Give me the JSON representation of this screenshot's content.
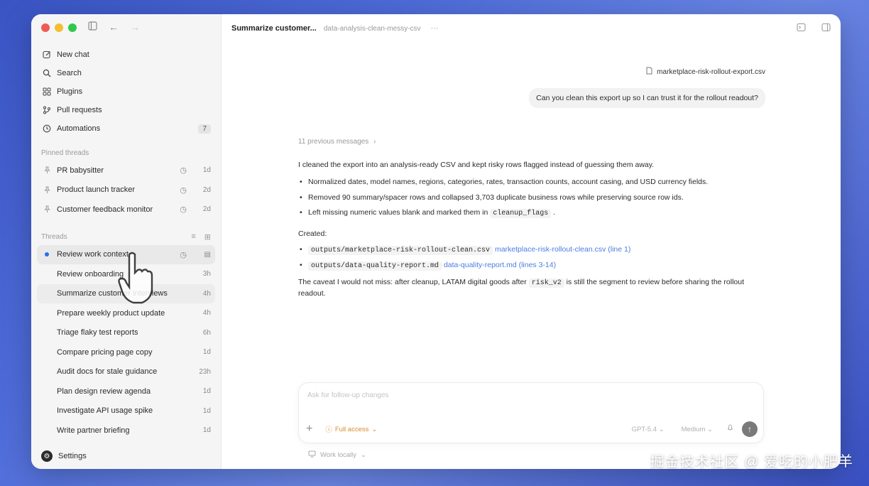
{
  "sidebar": {
    "nav": [
      {
        "label": "New chat",
        "icon": "edit-icon"
      },
      {
        "label": "Search",
        "icon": "search-icon"
      },
      {
        "label": "Plugins",
        "icon": "grid-icon"
      },
      {
        "label": "Pull requests",
        "icon": "branch-icon"
      },
      {
        "label": "Automations",
        "icon": "clock-icon",
        "badge": "7"
      }
    ],
    "pinned_label": "Pinned threads",
    "pinned": [
      {
        "title": "PR babysitter",
        "time": "1d"
      },
      {
        "title": "Product launch tracker",
        "time": "2d"
      },
      {
        "title": "Customer feedback monitor",
        "time": "2d"
      }
    ],
    "threads_label": "Threads",
    "threads": [
      {
        "title": "Review work context",
        "time": ""
      },
      {
        "title": "Review onboarding",
        "time": "3h"
      },
      {
        "title": "Summarize customer interviews",
        "time": "4h"
      },
      {
        "title": "Prepare weekly product update",
        "time": "4h"
      },
      {
        "title": "Triage flaky test reports",
        "time": "6h"
      },
      {
        "title": "Compare pricing page copy",
        "time": "1d"
      },
      {
        "title": "Audit docs for stale guidance",
        "time": "23h"
      },
      {
        "title": "Plan design review agenda",
        "time": "1d"
      },
      {
        "title": "Investigate API usage spike",
        "time": "1d"
      },
      {
        "title": "Write partner briefing",
        "time": "1d"
      }
    ],
    "settings_label": "Settings"
  },
  "topbar": {
    "title": "Summarize customer...",
    "subtitle": "data-analysis-clean-messy-csv",
    "more": "···"
  },
  "chat": {
    "attachment": "marketplace-risk-rollout-export.csv",
    "user_message": "Can you clean this export up so I can trust it for the rollout readout?",
    "previous": "11 previous messages",
    "intro": "I cleaned the export into an analysis-ready CSV and kept risky rows flagged instead of guessing them away.",
    "bullet1": "Normalized dates, model names, regions, categories, rates, transaction counts, account casing, and USD currency fields.",
    "bullet2": "Removed 90 summary/spacer rows and collapsed 3,703 duplicate business rows while preserving source row ids.",
    "bullet3_pre": "Left missing numeric values blank and marked them in",
    "bullet3_code": "cleanup_flags",
    "bullet3_post": ".",
    "created_label": "Created:",
    "file1_path": "outputs/marketplace-risk-rollout-clean.csv",
    "file1_link": "marketplace-risk-rollout-clean.csv (line 1)",
    "file2_path": "outputs/data-quality-report.md",
    "file2_link": "data-quality-report.md (lines 3-14)",
    "caveat_pre": "The caveat I would not miss: after cleanup, LATAM digital goods after",
    "caveat_code": "risk_v2",
    "caveat_post": "is still the segment to review before sharing the rollout readout."
  },
  "composer": {
    "placeholder": "Ask for follow-up changes",
    "access": "Full access",
    "model": "GPT-5.4",
    "effort": "Medium",
    "work_locally": "Work locally"
  },
  "watermark": "掘金技术社区 @ 爱吃的小肥羊"
}
